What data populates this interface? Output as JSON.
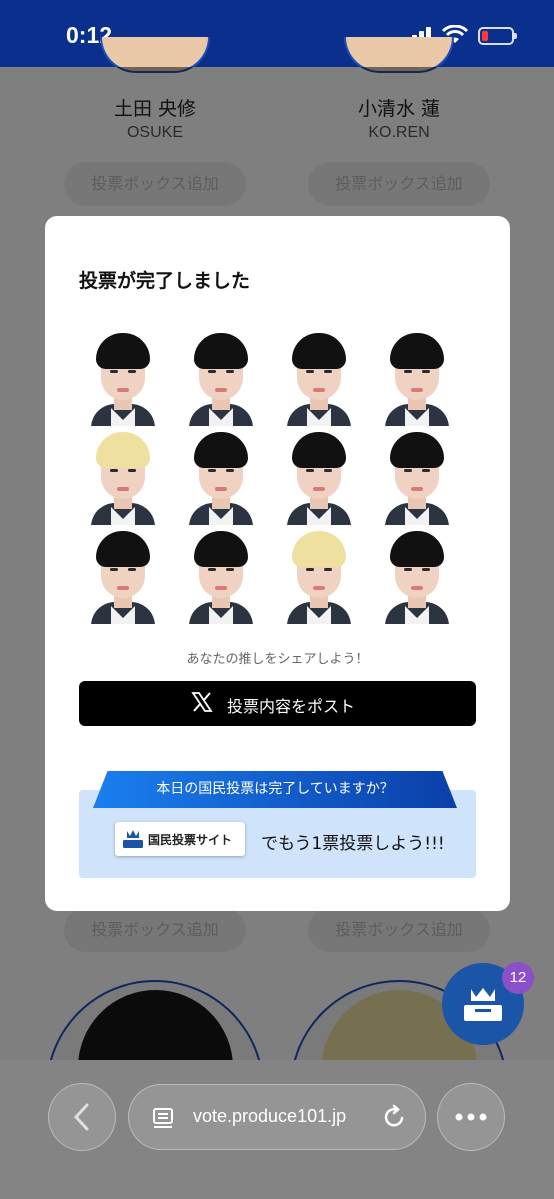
{
  "status_bar": {
    "time": "0:12"
  },
  "background": {
    "candidates": [
      {
        "name": "土田 央修",
        "roman": "OSUKE"
      },
      {
        "name": "小清水 蓮",
        "roman": "KO.REN"
      }
    ],
    "add_button_label": "投票ボックス追加"
  },
  "modal": {
    "title": "投票が完了しました",
    "photos": [
      {
        "hair": "black"
      },
      {
        "hair": "black"
      },
      {
        "hair": "black"
      },
      {
        "hair": "black"
      },
      {
        "hair": "blonde"
      },
      {
        "hair": "black"
      },
      {
        "hair": "black"
      },
      {
        "hair": "black"
      },
      {
        "hair": "black"
      },
      {
        "hair": "black"
      },
      {
        "hair": "blonde"
      },
      {
        "hair": "black"
      }
    ],
    "share_prompt": "あなたの推しをシェアしよう！",
    "post_button": "投票内容をポスト",
    "national_vote": {
      "question": "本日の国民投票は完了していますか？",
      "site_label": "国民投票サイト",
      "tail": "でもう1票投票しよう!!!"
    }
  },
  "fab": {
    "badge": "12"
  },
  "browser": {
    "url": "vote.produce101.jp"
  },
  "colors": {
    "header": "#0b2f8c",
    "accent": "#1a55a8",
    "black_hair": "#111111",
    "blonde_hair": "#efe0a0"
  }
}
